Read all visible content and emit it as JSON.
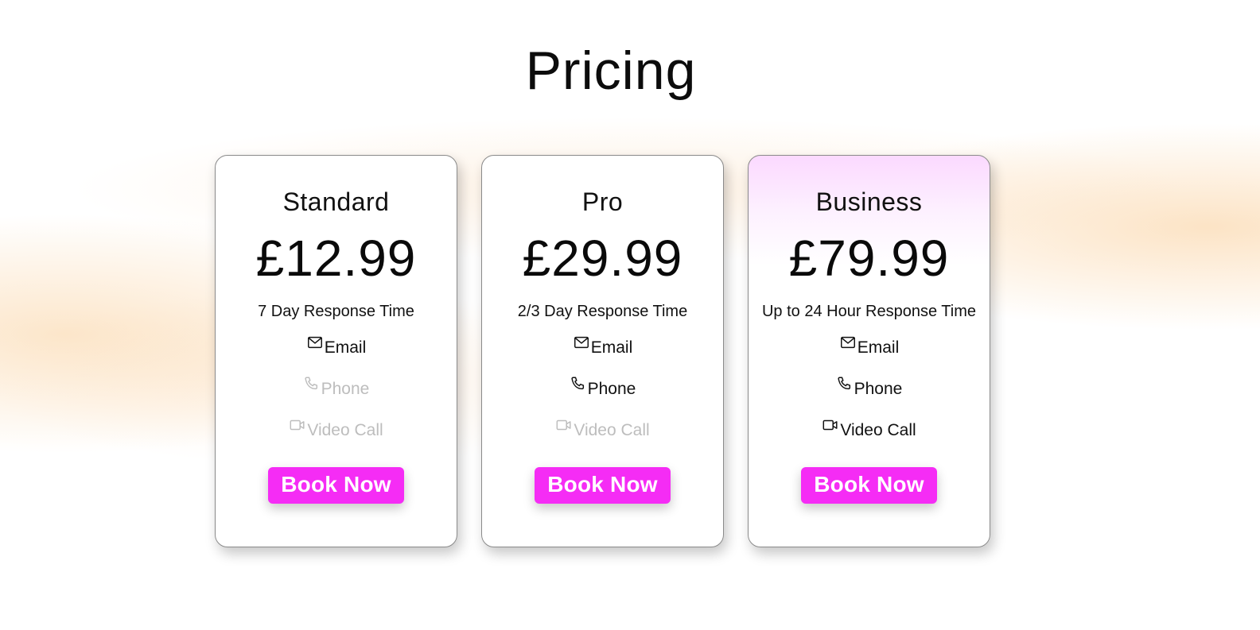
{
  "title": "Pricing",
  "colors": {
    "accent": "#f52cf5",
    "disabled_text": "#bdbdbd",
    "text": "#111111",
    "featured_tint": "#fbd9ff",
    "background_glow": "#fad2a0"
  },
  "plans": [
    {
      "name": "Standard",
      "price": "£12.99",
      "response": "7 Day Response Time",
      "features": [
        {
          "label": "Email",
          "icon": "mail-icon",
          "enabled": true
        },
        {
          "label": "Phone",
          "icon": "phone-icon",
          "enabled": false
        },
        {
          "label": "Video Call",
          "icon": "video-icon",
          "enabled": false
        }
      ],
      "button": "Book Now"
    },
    {
      "name": "Pro",
      "price": "£29.99",
      "response": "2/3 Day Response Time",
      "features": [
        {
          "label": "Email",
          "icon": "mail-icon",
          "enabled": true
        },
        {
          "label": "Phone",
          "icon": "phone-icon",
          "enabled": true
        },
        {
          "label": "Video Call",
          "icon": "video-icon",
          "enabled": false
        }
      ],
      "button": "Book Now"
    },
    {
      "name": "Business",
      "price": "£79.99",
      "response": "Up to 24 Hour Response Time",
      "features": [
        {
          "label": "Email",
          "icon": "mail-icon",
          "enabled": true
        },
        {
          "label": "Phone",
          "icon": "phone-icon",
          "enabled": true
        },
        {
          "label": "Video Call",
          "icon": "video-icon",
          "enabled": true
        }
      ],
      "button": "Book Now"
    }
  ]
}
